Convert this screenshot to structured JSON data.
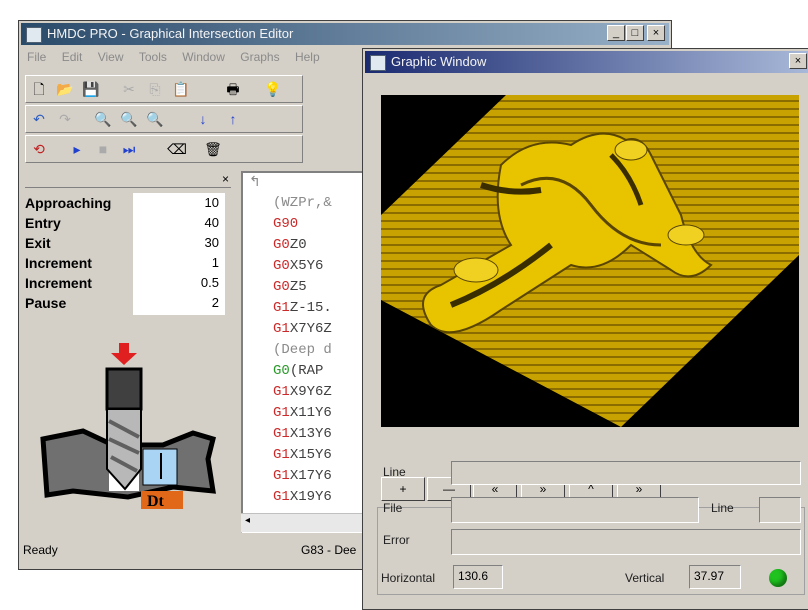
{
  "main_window": {
    "title": "HMDC PRO - Graphical Intersection Editor",
    "caption_buttons": {
      "minimize": "_",
      "maximize": "□",
      "close": "×"
    },
    "menu": [
      "File",
      "Edit",
      "View",
      "Tools",
      "Window",
      "Graphs",
      "Help"
    ],
    "toolbar1": {
      "new": "🗋",
      "open": "📂",
      "save": "💾",
      "cut": "✂",
      "copy": "⎘",
      "paste": "📋",
      "print": "🖶",
      "help": "💡"
    },
    "toolbar2": {
      "undo": "↶",
      "redo": "↷",
      "find": "🔍",
      "findprev": "🔍",
      "findnext": "🔍",
      "down": "↓",
      "up": "↑"
    },
    "toolbar3": {
      "cycle": "⟲",
      "step": "▸",
      "stop": "■",
      "skip": "⏭",
      "erase": "⌫",
      "clear": "🗑"
    },
    "params_scroll": "×",
    "params": [
      {
        "label": "Approaching",
        "value": "10"
      },
      {
        "label": "Entry",
        "value": "40"
      },
      {
        "label": "Exit",
        "value": "30"
      },
      {
        "label": "Increment",
        "value": "1"
      },
      {
        "label": "Increment",
        "value": "0.5"
      },
      {
        "label": "Pause",
        "value": "2"
      }
    ],
    "drill_label": "Dt",
    "code_lines": [
      {
        "prefix": "",
        "text": "(WZPr,&",
        "color": "#8a8a8a"
      },
      {
        "prefix": "G90",
        "text": "",
        "color": "#cc2a2a"
      },
      {
        "prefix": "G0",
        "text": "Z0",
        "color": "#cc2a2a"
      },
      {
        "prefix": "G0",
        "text": "X5Y6",
        "color": "#cc2a2a"
      },
      {
        "prefix": "G0",
        "text": "Z5",
        "color": "#cc2a2a"
      },
      {
        "prefix": "G1",
        "text": "Z-15.",
        "color": "#cc2a2a"
      },
      {
        "prefix": "G1",
        "text": "X7Y6Z",
        "color": "#cc2a2a"
      },
      {
        "prefix": "",
        "text": "(Deep d",
        "color": "#8a8a8a"
      },
      {
        "prefix": "G0",
        "text": "(RAP",
        "color": "#2a9a2a"
      },
      {
        "prefix": "G1",
        "text": "X9Y6Z",
        "color": "#cc2a2a"
      },
      {
        "prefix": "G1",
        "text": "X11Y6",
        "color": "#cc2a2a"
      },
      {
        "prefix": "G1",
        "text": "X13Y6",
        "color": "#cc2a2a"
      },
      {
        "prefix": "G1",
        "text": "X15Y6",
        "color": "#cc2a2a"
      },
      {
        "prefix": "G1",
        "text": "X17Y6",
        "color": "#cc2a2a"
      },
      {
        "prefix": "G1",
        "text": "X19Y6",
        "color": "#cc2a2a"
      }
    ],
    "status_left": "Ready",
    "status_right": "G83 - Dee"
  },
  "graphic_window": {
    "title": "Graphic Window",
    "close": "×",
    "nav_buttons": [
      "+",
      "—",
      "«",
      "»",
      "^",
      "»"
    ],
    "line_label": "Line",
    "file_label": "File",
    "line2_label": "Line",
    "error_label": "Error",
    "horizontal_label": "Horizontal",
    "horizontal_value": "130.6",
    "vertical_label": "Vertical",
    "vertical_value": "37.97",
    "status_color": "#1fc21f"
  }
}
